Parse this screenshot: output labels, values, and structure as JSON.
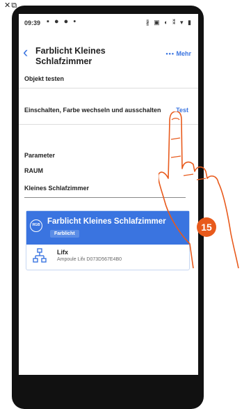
{
  "window_glyphs": "✕⧉",
  "status_bar": {
    "time": "09:39",
    "left_icons": "▪ ● ● •",
    "right_icons": "∦ ▣ ◐ ⁑ ▾ ▮"
  },
  "header": {
    "title": "Farblicht Kleines Schlafzimmer",
    "more_dots": "•••",
    "more_label": "Mehr"
  },
  "test_section": {
    "heading": "Objekt testen",
    "row_label": "Einschalten, Farbe wechseln und ausschalten",
    "test_link": "Test"
  },
  "parameters": {
    "heading": "Parameter",
    "room_label": "RAUM",
    "room_value": "Kleines Schlafzimmer"
  },
  "object_card": {
    "badge": "RGB",
    "title": "Farblicht Kleines Schlafzimmer",
    "type": "Farblicht",
    "device_name": "Lifx",
    "device_id": "Ampoule Lifx D073D567E4B0"
  },
  "step": {
    "number": "15"
  },
  "colors": {
    "accent": "#3a74e0",
    "step_badge": "#e85a1c",
    "hand_outline": "#e85a1c"
  }
}
